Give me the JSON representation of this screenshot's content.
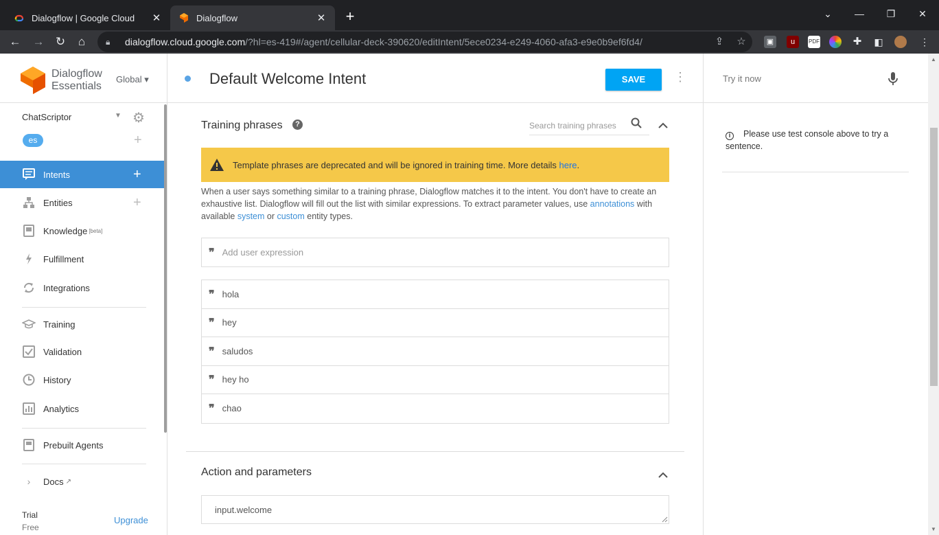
{
  "browser": {
    "tabs": [
      {
        "title": "Dialogflow | Google Cloud"
      },
      {
        "title": "Dialogflow"
      }
    ],
    "url_host": "dialogflow.cloud.google.com",
    "url_path": "/?hl=es-419#/agent/cellular-deck-390620/editIntent/5ece0234-e249-4060-afa3-e9e0b9ef6fd4/"
  },
  "brand": {
    "line1": "Dialogflow",
    "line2": "Essentials",
    "region": "Global"
  },
  "agent": {
    "name": "ChatScriptor",
    "language": "es"
  },
  "sidebar": {
    "items": [
      {
        "label": "Intents"
      },
      {
        "label": "Entities"
      },
      {
        "label": "Knowledge",
        "badge": "[beta]"
      },
      {
        "label": "Fulfillment"
      },
      {
        "label": "Integrations"
      },
      {
        "label": "Training"
      },
      {
        "label": "Validation"
      },
      {
        "label": "History"
      },
      {
        "label": "Analytics"
      },
      {
        "label": "Prebuilt Agents"
      },
      {
        "label": "Docs"
      }
    ],
    "trial_label": "Trial",
    "trial_plan": "Free",
    "upgrade_label": "Upgrade"
  },
  "intent": {
    "title": "Default Welcome Intent",
    "save_label": "SAVE"
  },
  "training": {
    "section_title": "Training phrases",
    "search_placeholder": "Search training phrases",
    "warning_text": "Template phrases are deprecated and will be ignored in training time. More details ",
    "warning_link": "here",
    "desc_1": "When a user says something similar to a training phrase, Dialogflow matches it to the intent. You don't have to create an exhaustive list. Dialogflow will fill out the list with similar expressions. To extract parameter values, use ",
    "desc_link_annotations": "annotations",
    "desc_2": " with available ",
    "desc_link_system": "system",
    "desc_3": " or ",
    "desc_link_custom": "custom",
    "desc_4": " entity types.",
    "add_placeholder": "Add user expression",
    "phrases": [
      "hola",
      "hey",
      "saludos",
      "hey ho",
      "chao"
    ]
  },
  "action": {
    "section_title": "Action and parameters",
    "value": "input.welcome"
  },
  "try_panel": {
    "placeholder": "Try it now",
    "info_text": "Please use test console above to try a sentence."
  }
}
